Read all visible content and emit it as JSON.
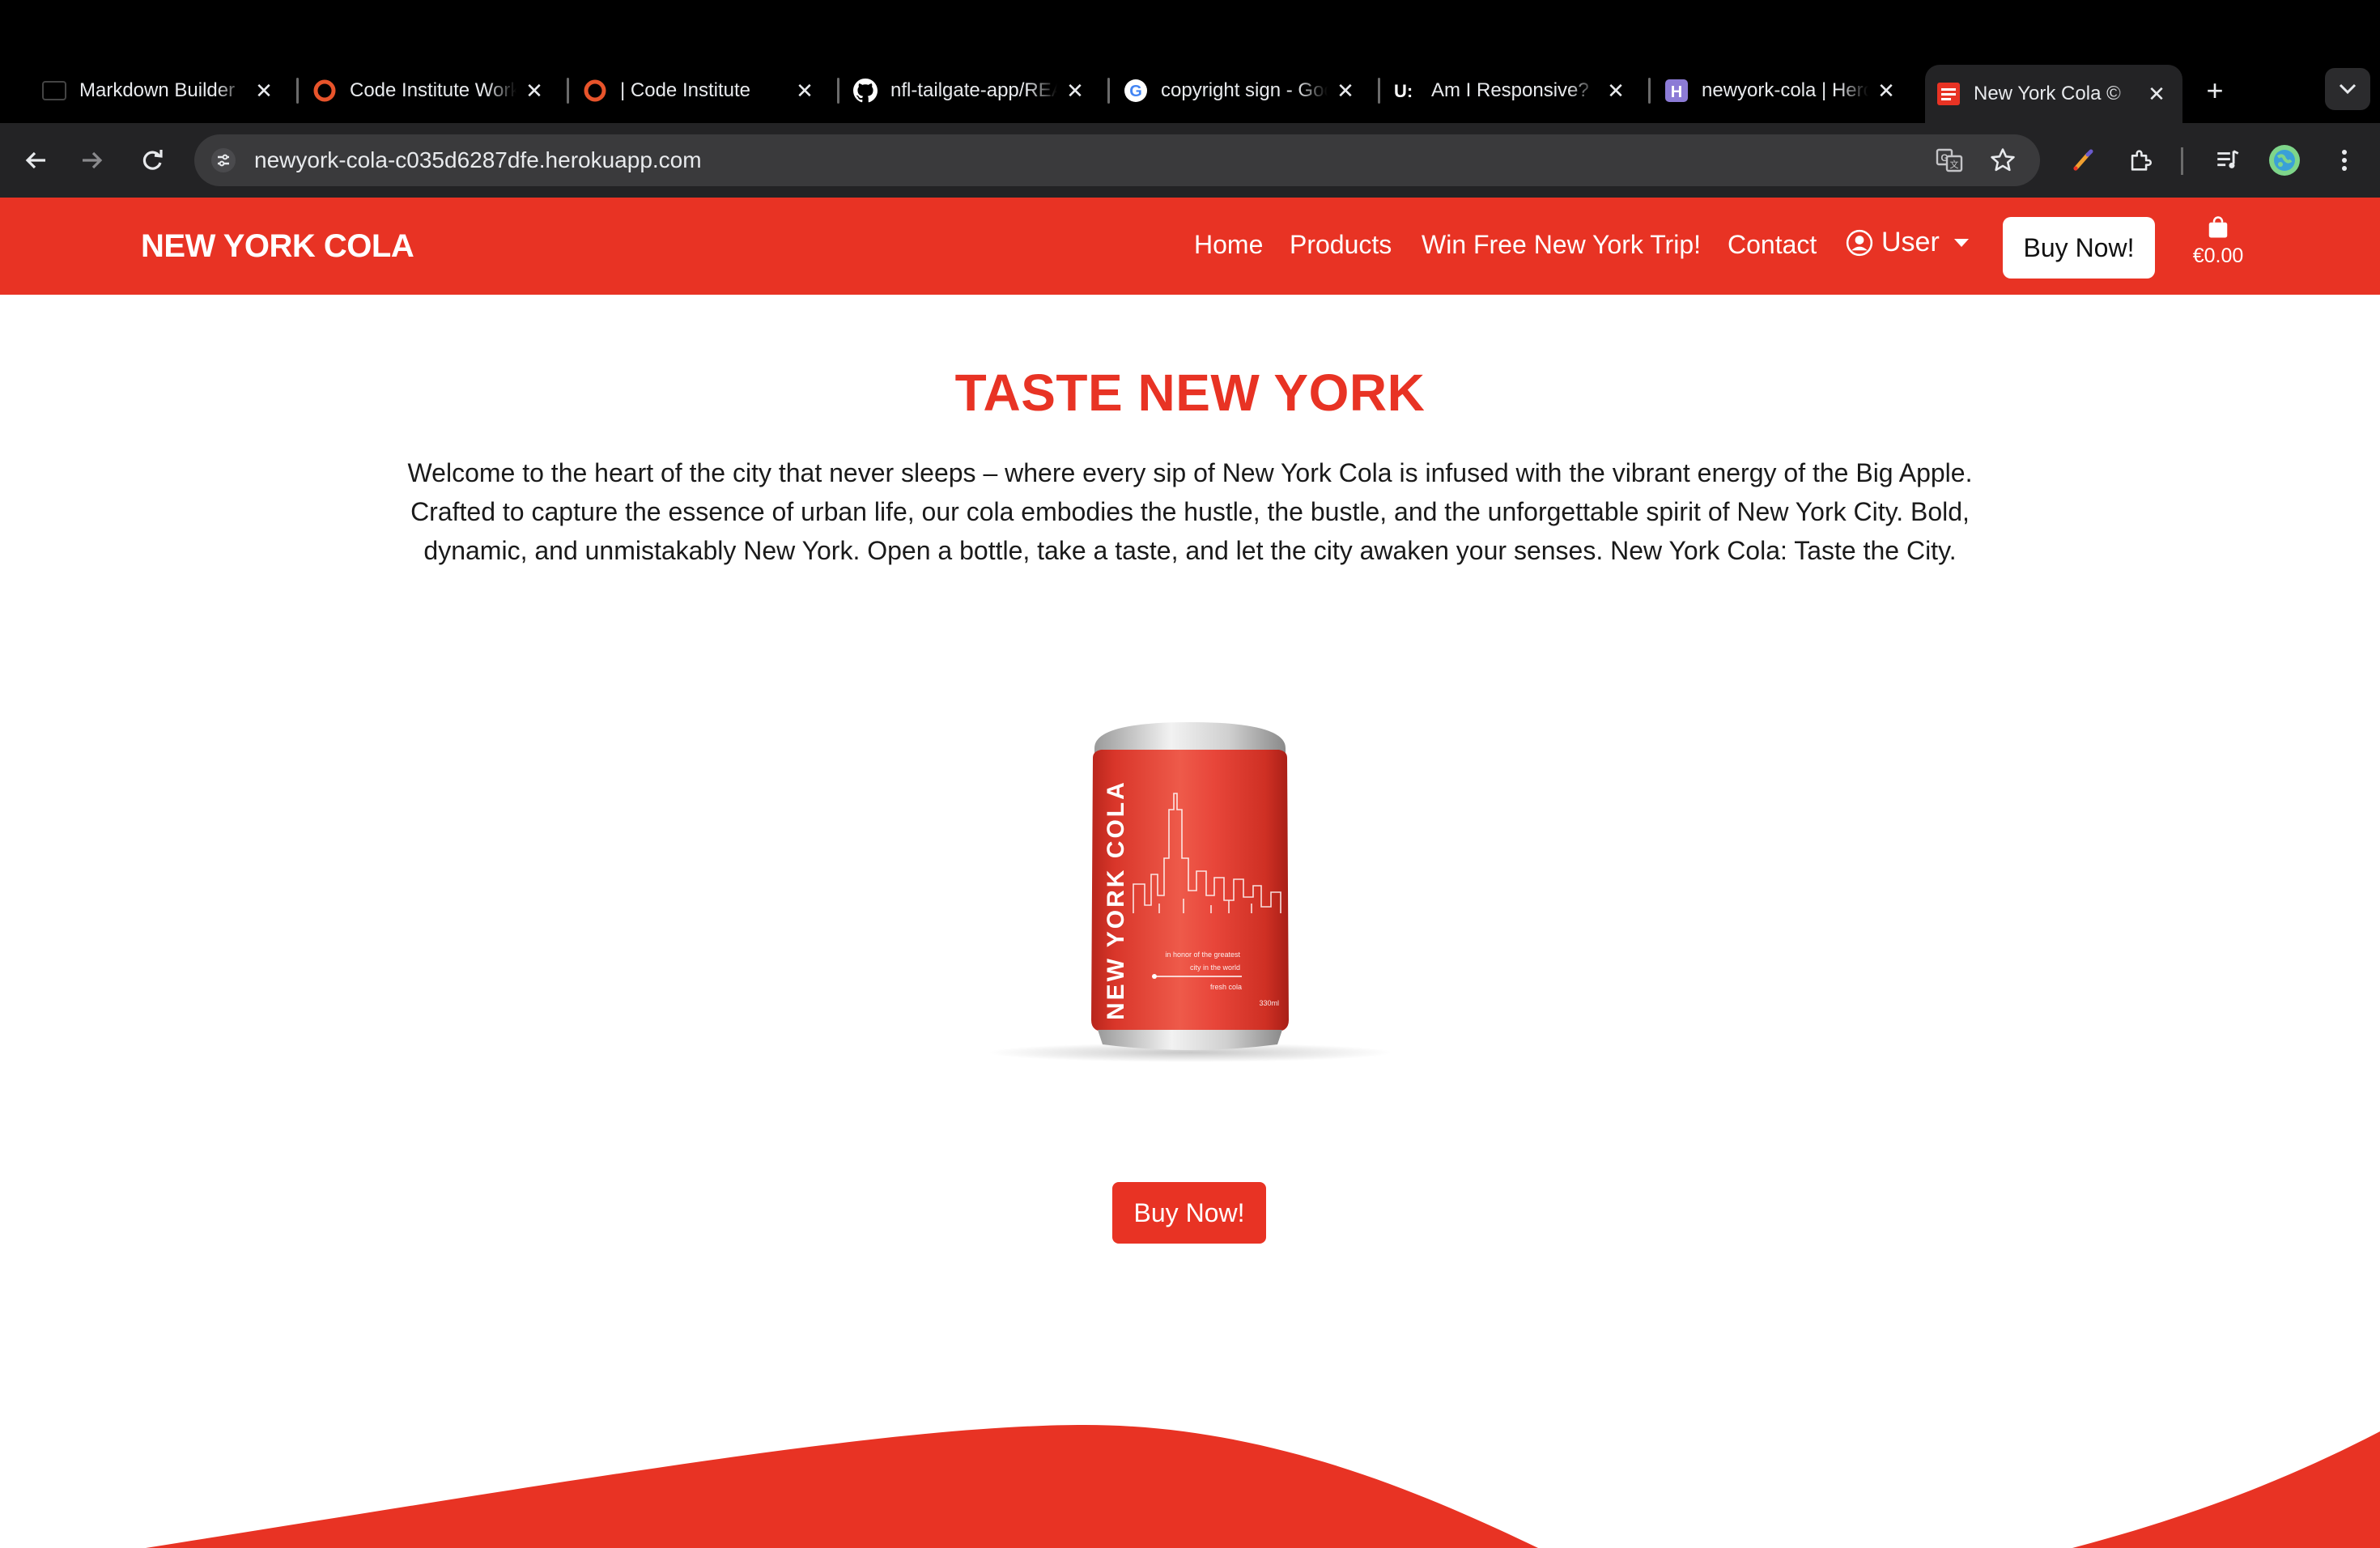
{
  "browser": {
    "tabs": [
      {
        "title": "Markdown Builder",
        "icon": "markdown-favicon"
      },
      {
        "title": "Code Institute Workspace",
        "icon": "code-institute-favicon"
      },
      {
        "title": "| Code Institute",
        "icon": "code-institute-favicon"
      },
      {
        "title": "nfl-tailgate-app/README",
        "icon": "github-favicon"
      },
      {
        "title": "copyright sign - Google",
        "icon": "google-favicon"
      },
      {
        "title": "Am I Responsive?",
        "icon": "amiresponsive-favicon"
      },
      {
        "title": "newyork-cola | Heroku",
        "icon": "heroku-favicon"
      },
      {
        "title": "New York Cola ©",
        "icon": "nycola-favicon",
        "active": true
      }
    ],
    "url": "newyork-cola-c035d6287dfe.herokuapp.com"
  },
  "navbar": {
    "brand": "NEW YORK COLA",
    "links": [
      "Home",
      "Products",
      "Win Free New York Trip!",
      "Contact"
    ],
    "user_label": "User",
    "buy_label": "Buy Now!",
    "bag_total": "€0.00"
  },
  "main": {
    "title": "TASTE NEW YORK",
    "text": "Welcome to the heart of the city that never sleeps – where every sip of New York Cola is infused with the vibrant energy of the Big Apple. Crafted to capture the essence of urban life, our cola embodies the hustle, the bustle, and the unforgettable spirit of New York City. Bold, dynamic, and unmistakably New York. Open a bottle, take a taste, and let the city awaken your senses. New York Cola: Taste the City.",
    "can": {
      "brand": "NEW YORK COLA",
      "tagline": [
        "in honor of the greatest",
        "city in the world"
      ],
      "sub": "fresh cola",
      "volume": "330ml"
    },
    "buy_label": "Buy Now!"
  },
  "colors": {
    "brand_red": "#e83324",
    "chrome_dark": "#232325"
  }
}
